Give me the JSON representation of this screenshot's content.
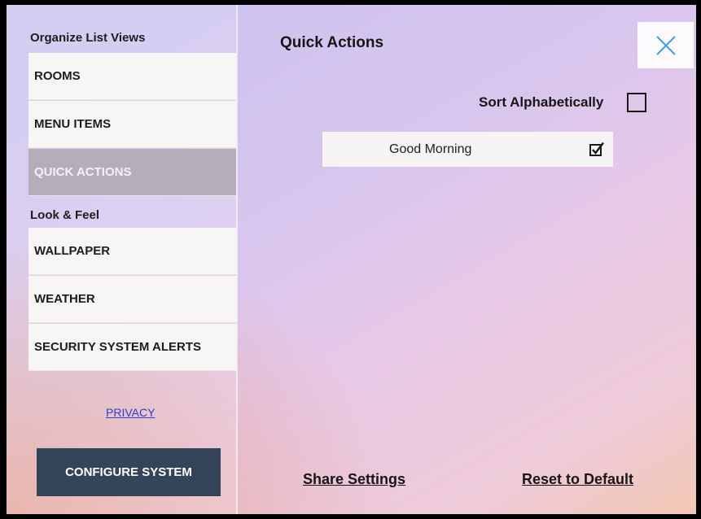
{
  "sidebar": {
    "section_organize": "Organize List Views",
    "section_look": "Look & Feel",
    "items": [
      {
        "label": "ROOMS"
      },
      {
        "label": "MENU ITEMS"
      },
      {
        "label": "QUICK ACTIONS",
        "active": true
      },
      {
        "label": "WALLPAPER"
      },
      {
        "label": "WEATHER"
      },
      {
        "label": "SECURITY SYSTEM ALERTS"
      }
    ],
    "privacy_link": "PRIVACY",
    "configure_button": "CONFIGURE SYSTEM"
  },
  "main": {
    "title": "Quick Actions",
    "sort_label": "Sort Alphabetically",
    "sort_checked": false,
    "quick_actions": [
      {
        "label": "Good Morning",
        "checked": true
      }
    ],
    "share_settings": "Share Settings",
    "reset_default": "Reset to Default"
  },
  "colors": {
    "active_item": "#b5adb9",
    "configure_button": "#344459",
    "close_icon": "#3aa0e6",
    "privacy_link": "#2a3fd0"
  },
  "icons": {
    "close": "close-icon",
    "sort_checkbox": "checkbox-unchecked-icon",
    "action_checkbox": "checkbox-checked-icon"
  }
}
